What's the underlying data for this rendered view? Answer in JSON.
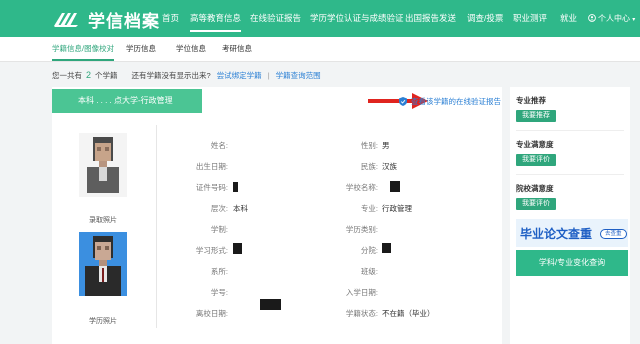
{
  "header": {
    "logo_text": "学信档案",
    "nav": [
      "首页",
      "高等教育信息",
      "在线验证报告",
      "学历学位认证与成绩验证",
      "出国报告发送",
      "调查/投票",
      "职业测评",
      "就业"
    ],
    "user_menu": "个人中心"
  },
  "subnav": [
    "学籍信息/图像校对",
    "学历信息",
    "学位信息",
    "考研信息"
  ],
  "summary": {
    "prefix": "您一共有",
    "count": "2",
    "suffix": "个学籍",
    "question": "还有学籍没有显示出来?",
    "link_bind": "尝试绑定学籍",
    "separator": "|",
    "link_scope": "学籍查询范围"
  },
  "record": {
    "tab_title": "本科      .      .   .  .   点大学-行政管理",
    "online_report_link": "查看该学籍的在线验证报告",
    "photo1_caption": "录取照片",
    "photo2_caption": "学历照片",
    "left_fields": [
      {
        "label": "姓名:",
        "value": ""
      },
      {
        "label": "出生日期:",
        "value": ""
      },
      {
        "label": "证件号码:",
        "value": ""
      },
      {
        "label": "层次:",
        "value": "本科"
      },
      {
        "label": "学制:",
        "value": ""
      },
      {
        "label": "学习形式:",
        "value": ""
      },
      {
        "label": "系所:",
        "value": ""
      },
      {
        "label": "学号:",
        "value": ""
      },
      {
        "label": "离校日期:",
        "value": ""
      }
    ],
    "right_fields": [
      {
        "label": "性别:",
        "value": "男"
      },
      {
        "label": "民族:",
        "value": "汉族"
      },
      {
        "label": "学校名称:",
        "value": ""
      },
      {
        "label": "专业:",
        "value": "行政管理"
      },
      {
        "label": "学历类别:",
        "value": ""
      },
      {
        "label": "分院:",
        "value": ""
      },
      {
        "label": "班级:",
        "value": ""
      },
      {
        "label": "入学日期:",
        "value": ""
      },
      {
        "label": "学籍状态:",
        "value": "不在籍（毕业）"
      }
    ]
  },
  "sidebar": {
    "sections": [
      {
        "title": "专业推荐",
        "button": "我要推荐"
      },
      {
        "title": "专业满意度",
        "button": "我要评价"
      },
      {
        "title": "院校满意度",
        "button": "我要评价"
      }
    ],
    "banner_text": "毕业论文查重",
    "banner_pill": "去查重",
    "change_query_button": "学科/专业变化查询"
  },
  "colors": {
    "brand": "#2fb88a",
    "link": "#2a7fd4",
    "arrow": "#e0241f"
  }
}
